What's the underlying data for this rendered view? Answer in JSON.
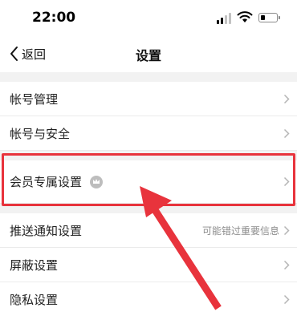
{
  "status_bar": {
    "time": "22:00",
    "icons": [
      "signal-icon",
      "wifi-icon",
      "battery-icon"
    ]
  },
  "nav": {
    "back_label": "返回",
    "title": "设置"
  },
  "items": [
    {
      "label": "帐号管理"
    },
    {
      "label": "帐号与安全"
    },
    {
      "label": "会员专属设置",
      "badge_icon": "crown-icon"
    },
    {
      "label": "推送通知设置",
      "sub": "可能错过重要信息"
    },
    {
      "label": "屏蔽设置"
    },
    {
      "label": "隐私设置"
    }
  ],
  "colors": {
    "annotation": "#e8333c",
    "background": "#f2f2f2",
    "row_background": "#ffffff"
  }
}
